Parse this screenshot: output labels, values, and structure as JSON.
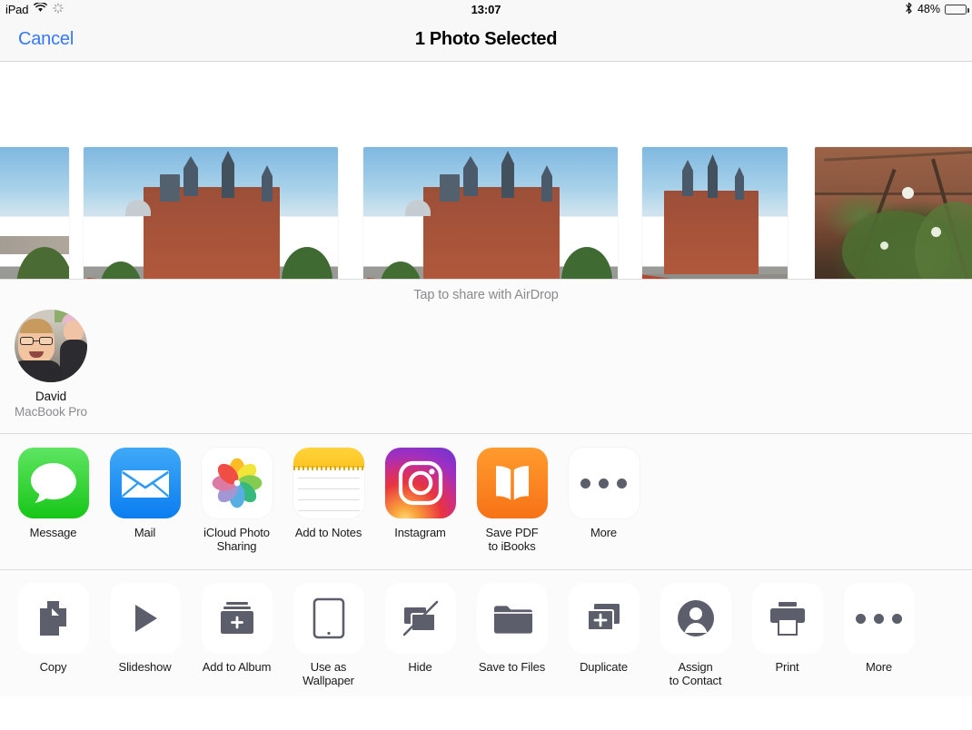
{
  "statusbar": {
    "device": "iPad",
    "wifi_icon": "wifi-icon",
    "activity_icon": "activity-spinner-icon",
    "time": "13:07",
    "bluetooth_icon": "bluetooth-icon",
    "battery_percent": "48%",
    "battery_level": 48
  },
  "navbar": {
    "cancel_label": "Cancel",
    "title": "1 Photo Selected"
  },
  "photostrip": {
    "photos": [
      {
        "id": "photo-1",
        "alt": "st-pancras-station-wide",
        "selected": false,
        "partial": true
      },
      {
        "id": "photo-2",
        "alt": "st-pancras-station-front",
        "selected": false,
        "partial": false
      },
      {
        "id": "photo-3",
        "alt": "st-pancras-station-front-duplicate",
        "selected": true,
        "partial": false
      },
      {
        "id": "photo-4",
        "alt": "st-pancras-station-angle",
        "selected": false,
        "partial": false
      },
      {
        "id": "photo-5",
        "alt": "garden-plant-brick-wall",
        "selected": false,
        "partial": true
      }
    ]
  },
  "airdrop": {
    "hint": "Tap to share with AirDrop",
    "contacts": [
      {
        "name": "David",
        "device": "MacBook Pro",
        "avatar": "portrait-man-and-child"
      }
    ]
  },
  "apps": {
    "items": [
      {
        "label": "Message",
        "icon": "message-bubble-icon",
        "icon_class": "ic-message"
      },
      {
        "label": "Mail",
        "icon": "mail-envelope-icon",
        "icon_class": "ic-mail"
      },
      {
        "label": "iCloud Photo\nSharing",
        "icon": "photos-pinwheel-icon",
        "icon_class": "ic-photos"
      },
      {
        "label": "Add to Notes",
        "icon": "notes-icon",
        "icon_class": "ic-notes"
      },
      {
        "label": "Instagram",
        "icon": "instagram-camera-icon",
        "icon_class": "ic-insta"
      },
      {
        "label": "Save PDF\nto iBooks",
        "icon": "ibooks-open-book-icon",
        "icon_class": "ic-ibooks"
      },
      {
        "label": "More",
        "icon": "ellipsis-icon",
        "icon_class": "ic-more"
      }
    ]
  },
  "actions": {
    "items": [
      {
        "label": "Copy",
        "icon": "copy-documents-icon"
      },
      {
        "label": "Slideshow",
        "icon": "play-triangle-icon"
      },
      {
        "label": "Add to Album",
        "icon": "album-plus-icon"
      },
      {
        "label": "Use as\nWallpaper",
        "icon": "tablet-wallpaper-icon"
      },
      {
        "label": "Hide",
        "icon": "hide-slash-icon"
      },
      {
        "label": "Save to Files",
        "icon": "folder-icon"
      },
      {
        "label": "Duplicate",
        "icon": "duplicate-plus-icon"
      },
      {
        "label": "Assign\nto Contact",
        "icon": "person-circle-icon"
      },
      {
        "label": "Print",
        "icon": "printer-icon"
      },
      {
        "label": "More",
        "icon": "ellipsis-icon"
      }
    ]
  },
  "colors": {
    "accent_blue": "#3478f6",
    "selected_check_blue": "#147efb",
    "background": "#fbfbfb",
    "icon_gray": "#5c5f6b",
    "secondary_text": "#8a8a8e"
  }
}
